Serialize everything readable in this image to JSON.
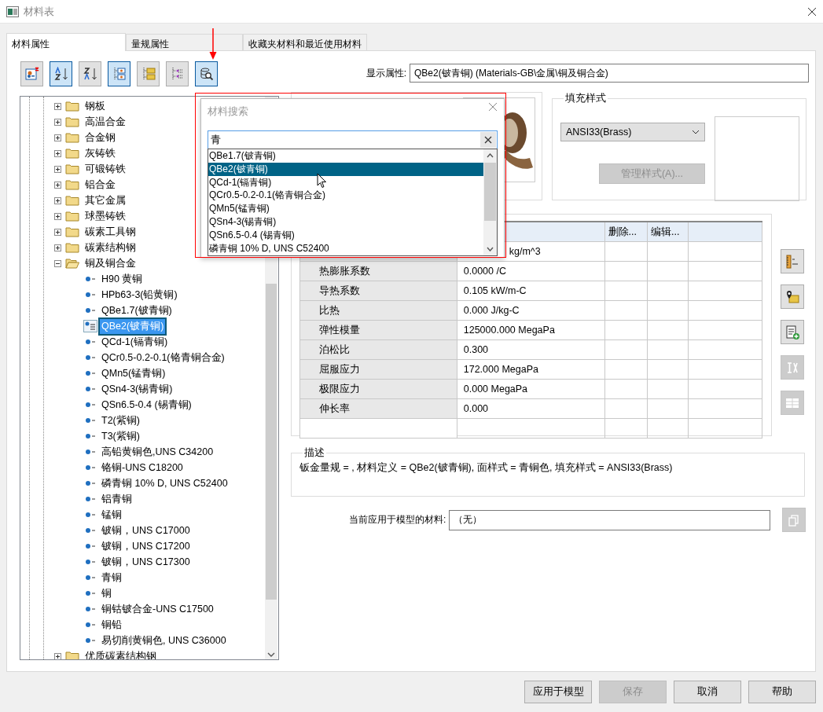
{
  "window": {
    "title": "材料表"
  },
  "tabs": [
    {
      "label": "材料属性",
      "selected": true
    },
    {
      "label": "量规属性",
      "selected": false
    },
    {
      "label": "收藏夹材料和最近使用材料",
      "selected": false
    }
  ],
  "toolbar": [
    {
      "kind": "new",
      "selected": false
    },
    {
      "kind": "sort-az",
      "selected": true
    },
    {
      "kind": "sort-za",
      "selected": false
    },
    {
      "kind": "nodes",
      "selected": true
    },
    {
      "kind": "folders",
      "selected": false
    },
    {
      "kind": "list",
      "selected": false
    },
    {
      "kind": "search",
      "selected": true
    }
  ],
  "tree": {
    "items": [
      {
        "label": "钢板",
        "expanded": false
      },
      {
        "label": "高温合金",
        "expanded": false
      },
      {
        "label": "合金钢",
        "expanded": false
      },
      {
        "label": "灰铸铁",
        "expanded": false
      },
      {
        "label": "可锻铸铁",
        "expanded": false
      },
      {
        "label": "铝合金",
        "expanded": false
      },
      {
        "label": "其它金属",
        "expanded": false
      },
      {
        "label": "球墨铸铁",
        "expanded": false
      },
      {
        "label": "碳素工具钢",
        "expanded": false
      },
      {
        "label": "碳素结构钢",
        "expanded": false
      },
      {
        "label": "铜及铜合金",
        "expanded": true,
        "children": [
          {
            "label": "H90 黄铜",
            "selected": false
          },
          {
            "label": "HPb63-3(铅黄铜)",
            "selected": false
          },
          {
            "label": "QBe1.7(铍青铜)",
            "selected": false
          },
          {
            "label": "QBe2(铍青铜)",
            "selected": true
          },
          {
            "label": "QCd-1(镉青铜)",
            "selected": false
          },
          {
            "label": "QCr0.5-0.2-0.1(铬青铜合金)",
            "selected": false
          },
          {
            "label": "QMn5(锰青铜)",
            "selected": false
          },
          {
            "label": "QSn4-3(锡青铜)",
            "selected": false
          },
          {
            "label": "QSn6.5-0.4 (锡青铜)",
            "selected": false
          },
          {
            "label": "T2(紫铜)",
            "selected": false
          },
          {
            "label": "T3(紫铜)",
            "selected": false
          },
          {
            "label": "高铅黄铜色,UNS C34200",
            "selected": false
          },
          {
            "label": "铬铜-UNS C18200",
            "selected": false
          },
          {
            "label": "磷青铜 10% D, UNS C52400",
            "selected": false
          },
          {
            "label": "铝青铜",
            "selected": false
          },
          {
            "label": "锰铜",
            "selected": false
          },
          {
            "label": "铍铜，UNS C17000",
            "selected": false
          },
          {
            "label": "铍铜，UNS C17200",
            "selected": false
          },
          {
            "label": "铍铜，UNS C17300",
            "selected": false
          },
          {
            "label": "青铜",
            "selected": false
          },
          {
            "label": "铜",
            "selected": false
          },
          {
            "label": "铜钴铍合金-UNS C17500",
            "selected": false
          },
          {
            "label": "铜铅",
            "selected": false
          },
          {
            "label": "易切削黄铜色, UNS C36000",
            "selected": false
          }
        ]
      },
      {
        "label": "优质碳素结构钢",
        "expanded": false
      }
    ]
  },
  "display_property": {
    "label": "显示属性:",
    "value": "QBe2(铍青铜) (Materials-GB\\金属\\铜及铜合金)"
  },
  "fill_style": {
    "title": "填充样式",
    "dropdown": "ANSI33(Brass)",
    "manage_button": "管理样式(A)...",
    "manage_disabled": true
  },
  "table": {
    "columns": [
      "删除...",
      "编辑..."
    ],
    "rows": [
      {
        "value": "kg/m^3"
      },
      {
        "name": "热膨胀系数",
        "value": "0.0000 /C"
      },
      {
        "name": "导热系数",
        "value": "0.105 kW/m-C"
      },
      {
        "name": "比热",
        "value": "0.000 J/kg-C"
      },
      {
        "name": "弹性模量",
        "value": "125000.000 MegaPa"
      },
      {
        "name": "泊松比",
        "value": "0.300"
      },
      {
        "name": "屈服应力",
        "value": "172.000 MegaPa"
      },
      {
        "name": "极限应力",
        "value": "0.000 MegaPa"
      },
      {
        "name": "伸长率",
        "value": "0.000"
      }
    ]
  },
  "side_buttons": [
    {
      "kind": "units",
      "disabled": false
    },
    {
      "kind": "location",
      "disabled": false
    },
    {
      "kind": "add-sheet",
      "disabled": false
    },
    {
      "kind": "edit",
      "disabled": true
    },
    {
      "kind": "grid",
      "disabled": true
    }
  ],
  "description": {
    "title": "描述",
    "text": "钣金量规 = , 材料定义 = QBe2(铍青铜), 面样式 = 青铜色, 填充样式 = ANSI33(Brass)"
  },
  "current_material": {
    "label": "当前应用于模型的材料:",
    "value": "（无）",
    "button_disabled": true
  },
  "buttons": [
    {
      "label": "应用于模型",
      "disabled": false
    },
    {
      "label": "保存",
      "disabled": true
    },
    {
      "label": "取消",
      "disabled": false
    },
    {
      "label": "帮助",
      "disabled": false
    }
  ],
  "search_popup": {
    "title": "材料搜索",
    "query": "青",
    "results": [
      {
        "label": "QBe1.7(铍青铜)",
        "selected": false
      },
      {
        "label": "QBe2(铍青铜)",
        "selected": true
      },
      {
        "label": "QCd-1(镉青铜)",
        "selected": false
      },
      {
        "label": "QCr0.5-0.2-0.1(铬青铜合金)",
        "selected": false
      },
      {
        "label": "QMn5(锰青铜)",
        "selected": false
      },
      {
        "label": "QSn4-3(锡青铜)",
        "selected": false
      },
      {
        "label": "QSn6.5-0.4 (锡青铜)",
        "selected": false
      },
      {
        "label": "磷青铜 10% D, UNS C52400",
        "selected": false
      }
    ]
  }
}
